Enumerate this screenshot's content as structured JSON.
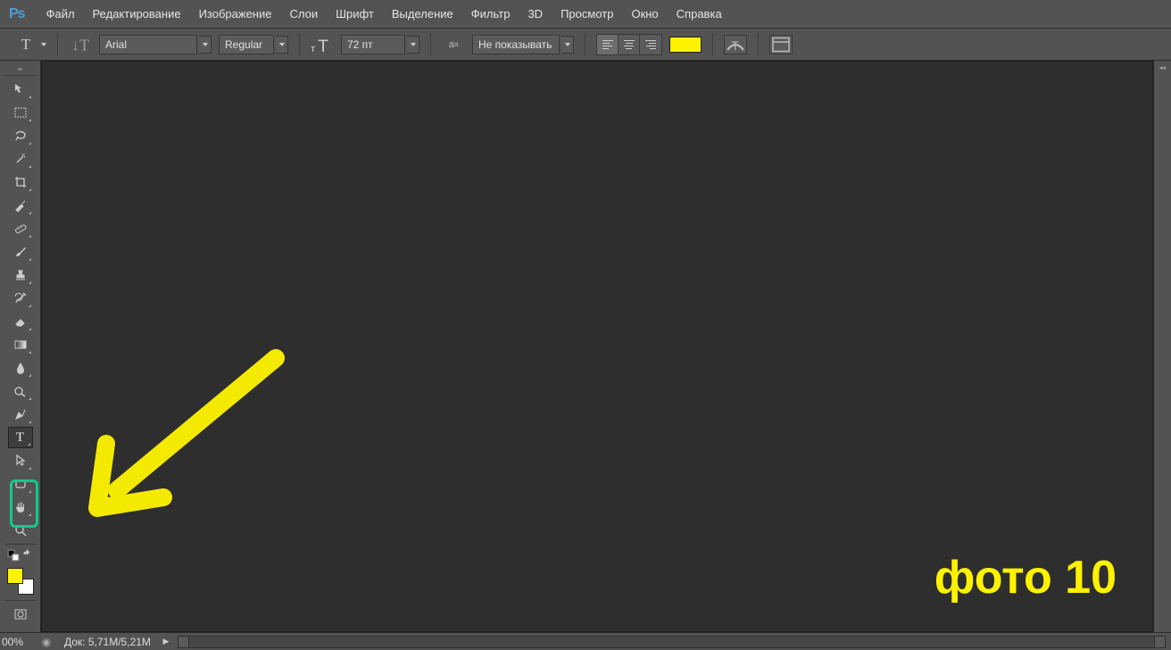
{
  "app": {
    "logo": "Ps"
  },
  "menu": {
    "items": [
      "Файл",
      "Редактирование",
      "Изображение",
      "Слои",
      "Шрифт",
      "Выделение",
      "Фильтр",
      "3D",
      "Просмотр",
      "Окно",
      "Справка"
    ]
  },
  "options": {
    "font_family": "Arial",
    "font_weight": "Regular",
    "font_size": "72 пт",
    "antialias": "Не показывать",
    "text_color": "#fff200"
  },
  "tools": {
    "fg_color": "#fff200",
    "bg_color": "#ffffff"
  },
  "status": {
    "zoom": "00%",
    "doc_label": "Док:",
    "doc_value": "5,71M/5,21M",
    "arrow": "▶"
  },
  "annotation": {
    "caption": "фото 10"
  }
}
